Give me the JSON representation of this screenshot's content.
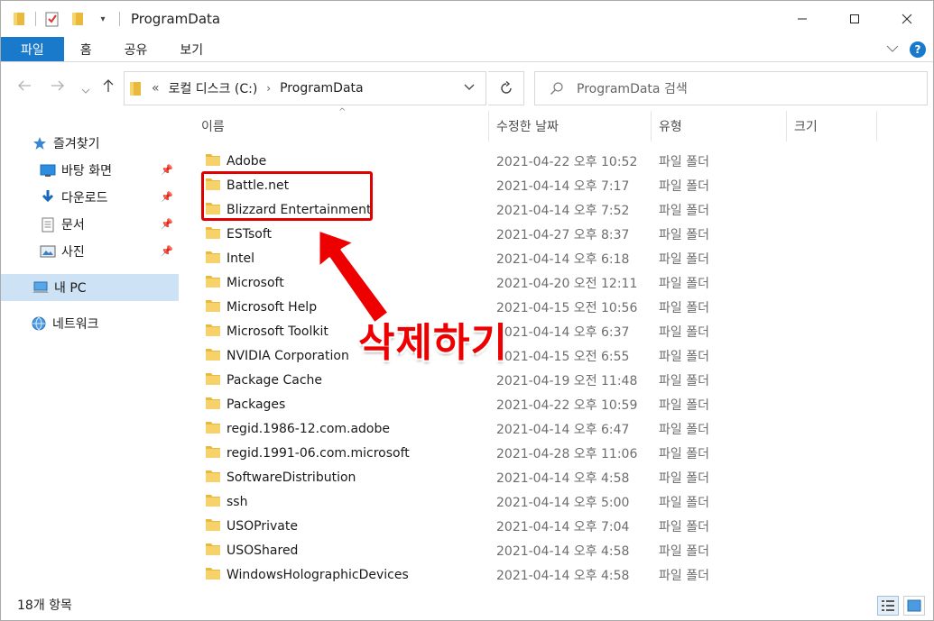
{
  "window": {
    "title": "ProgramData"
  },
  "ribbon": {
    "tabs": [
      "파일",
      "홈",
      "공유",
      "보기"
    ]
  },
  "address": {
    "breadcrumbs": [
      "로컬 디스크 (C:)",
      "ProgramData"
    ],
    "overflow": "«"
  },
  "search": {
    "placeholder": "ProgramData 검색"
  },
  "sidebar": {
    "items": [
      {
        "label": "즐겨찾기",
        "icon": "star-icon"
      },
      {
        "label": "바탕 화면",
        "icon": "desktop-icon"
      },
      {
        "label": "다운로드",
        "icon": "download-icon"
      },
      {
        "label": "문서",
        "icon": "document-icon"
      },
      {
        "label": "사진",
        "icon": "picture-icon"
      },
      {
        "label": "내 PC",
        "icon": "computer-icon"
      },
      {
        "label": "네트워크",
        "icon": "network-icon"
      }
    ]
  },
  "columns": {
    "name": "이름",
    "date": "수정한 날짜",
    "type": "유형",
    "size": "크기"
  },
  "files": [
    {
      "name": "Adobe",
      "date": "2021-04-22 오후 10:52",
      "type": "파일 폴더"
    },
    {
      "name": "Battle.net",
      "date": "2021-04-14 오후 7:17",
      "type": "파일 폴더"
    },
    {
      "name": "Blizzard Entertainment",
      "date": "2021-04-14 오후 7:52",
      "type": "파일 폴더"
    },
    {
      "name": "ESTsoft",
      "date": "2021-04-27 오후 8:37",
      "type": "파일 폴더"
    },
    {
      "name": "Intel",
      "date": "2021-04-14 오후 6:18",
      "type": "파일 폴더"
    },
    {
      "name": "Microsoft",
      "date": "2021-04-20 오전 12:11",
      "type": "파일 폴더"
    },
    {
      "name": "Microsoft Help",
      "date": "2021-04-15 오전 10:56",
      "type": "파일 폴더"
    },
    {
      "name": "Microsoft Toolkit",
      "date": "2021-04-14 오후 6:37",
      "type": "파일 폴더"
    },
    {
      "name": "NVIDIA Corporation",
      "date": "2021-04-15 오전 6:55",
      "type": "파일 폴더"
    },
    {
      "name": "Package Cache",
      "date": "2021-04-19 오전 11:48",
      "type": "파일 폴더"
    },
    {
      "name": "Packages",
      "date": "2021-04-22 오후 10:59",
      "type": "파일 폴더"
    },
    {
      "name": "regid.1986-12.com.adobe",
      "date": "2021-04-14 오후 6:47",
      "type": "파일 폴더"
    },
    {
      "name": "regid.1991-06.com.microsoft",
      "date": "2021-04-28 오후 11:06",
      "type": "파일 폴더"
    },
    {
      "name": "SoftwareDistribution",
      "date": "2021-04-14 오후 4:58",
      "type": "파일 폴더"
    },
    {
      "name": "ssh",
      "date": "2021-04-14 오후 5:00",
      "type": "파일 폴더"
    },
    {
      "name": "USOPrivate",
      "date": "2021-04-14 오후 7:04",
      "type": "파일 폴더"
    },
    {
      "name": "USOShared",
      "date": "2021-04-14 오후 4:58",
      "type": "파일 폴더"
    },
    {
      "name": "WindowsHolographicDevices",
      "date": "2021-04-14 오후 4:58",
      "type": "파일 폴더"
    }
  ],
  "status": {
    "count": "18개 항목"
  },
  "annotation": {
    "text": "삭제하기",
    "color": "#ee0000"
  },
  "colors": {
    "accent": "#1979ca",
    "folder": "#f2c94c",
    "selection": "#cde2f5"
  }
}
